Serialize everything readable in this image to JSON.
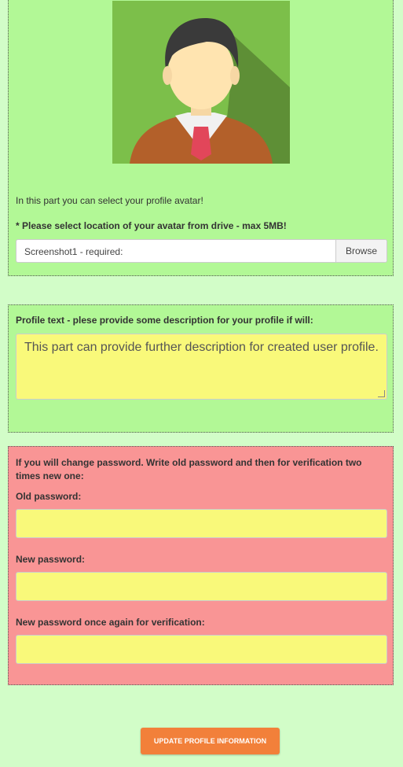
{
  "avatar_section": {
    "intro_text": "In this part you can select your profile avatar!",
    "upload_label": "* Please select location of your avatar from drive - max 5MB!",
    "file_value": "Screenshot1 - required:",
    "browse_label": "Browse"
  },
  "profile_section": {
    "label": "Profile text - plese provide some description for your profile if will:",
    "textarea_value": "This part can provide further description for created user profile."
  },
  "password_section": {
    "intro_text": "If you will change password. Write old password and then for verification two times new one:",
    "old_password_label": "Old password:",
    "new_password_label": "New password:",
    "confirm_password_label": "New password once again for verification:"
  },
  "submit_label": "UPDATE PROFILE INFORMATION",
  "colors": {
    "page_background": "#d2fdc8",
    "green_panel": "#b2f896",
    "red_panel": "#f99595",
    "input_yellow": "#f9f97a",
    "button_orange": "#f2803a"
  }
}
